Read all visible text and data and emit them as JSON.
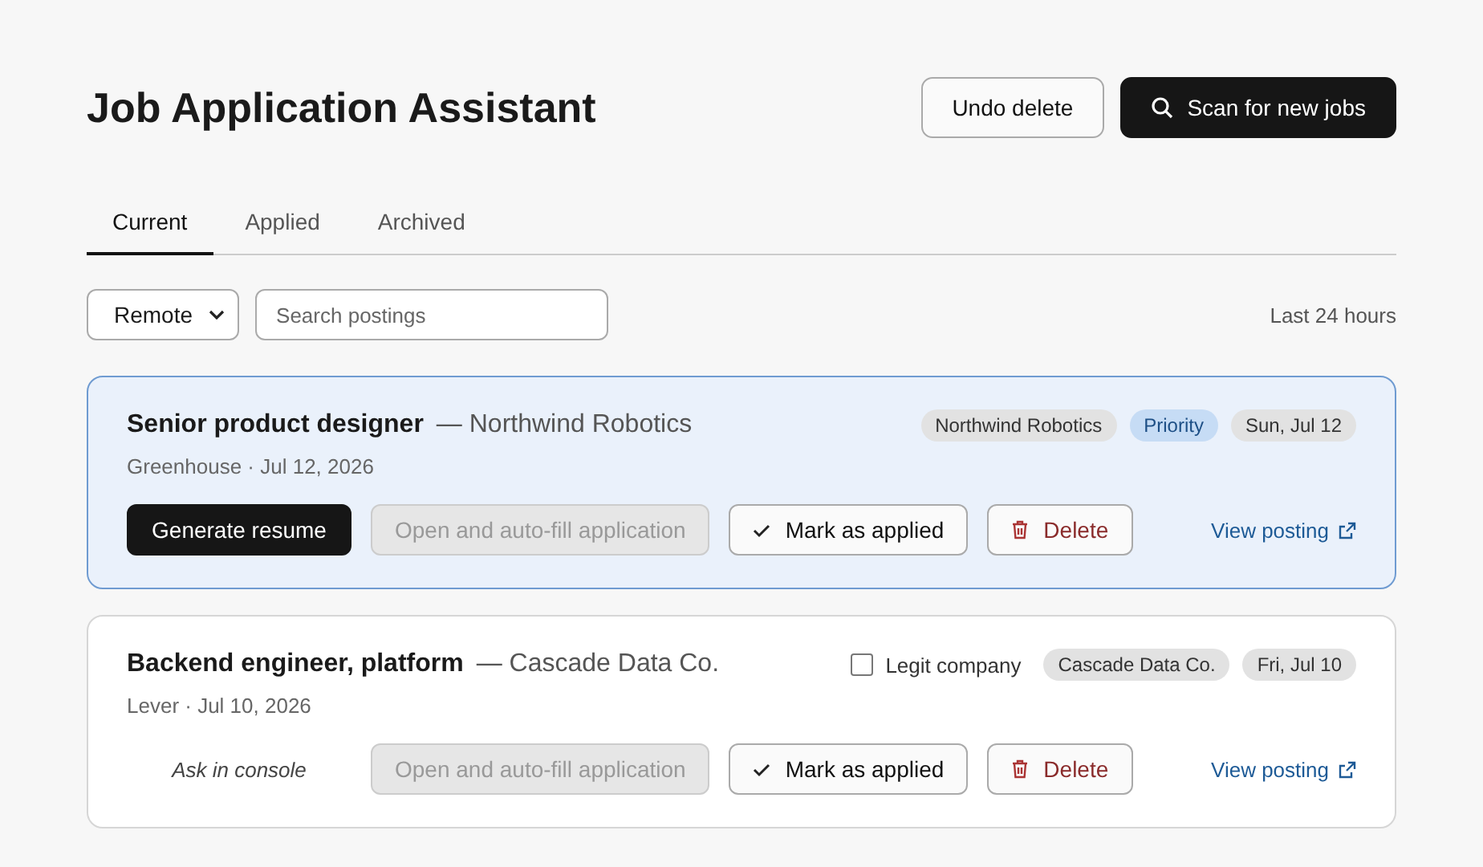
{
  "header": {
    "title": "Job Application Assistant",
    "buttons": [
      {
        "label": "Undo delete",
        "kind": "secondary"
      },
      {
        "label": "Scan for new jobs",
        "kind": "primary"
      }
    ]
  },
  "tabs": [
    {
      "label": "Current",
      "selected": true
    },
    {
      "label": "Applied",
      "selected": false
    },
    {
      "label": "Archived",
      "selected": false
    }
  ],
  "filters": {
    "location": "Remote",
    "search": {
      "placeholder": "Search postings"
    },
    "range": "Last 24 hours"
  },
  "jobs": [
    {
      "selected": true,
      "title": "Senior product designer",
      "company": "— Northwind Robotics",
      "meta": "Greenhouse · Jul 12, 2026",
      "tags": [
        {
          "label": "Northwind Robotics",
          "kind": "plain"
        },
        {
          "label": "Priority",
          "kind": "priority"
        },
        {
          "label": "Sun, Jul 12",
          "kind": "plain"
        }
      ],
      "first_action": {
        "kind": "button",
        "label": "Generate resume"
      },
      "autofill": {
        "label": "Open and auto-fill application",
        "disabled": true
      },
      "mark": "Mark as applied",
      "delete": "Delete",
      "link": "View posting"
    },
    {
      "selected": false,
      "title": "Backend engineer, platform",
      "company": "— Cascade Data Co.",
      "meta": "Lever · Jul 10, 2026",
      "legit": {
        "label": "Legit company",
        "checked": false
      },
      "tags": [
        {
          "label": "Cascade Data Co.",
          "kind": "plain"
        },
        {
          "label": "Fri, Jul 10",
          "kind": "plain"
        }
      ],
      "first_action": {
        "kind": "note",
        "label": "Ask in console"
      },
      "autofill": {
        "label": "Open and auto-fill application",
        "disabled": true
      },
      "mark": "Mark as applied",
      "delete": "Delete",
      "link": "View posting"
    }
  ]
}
